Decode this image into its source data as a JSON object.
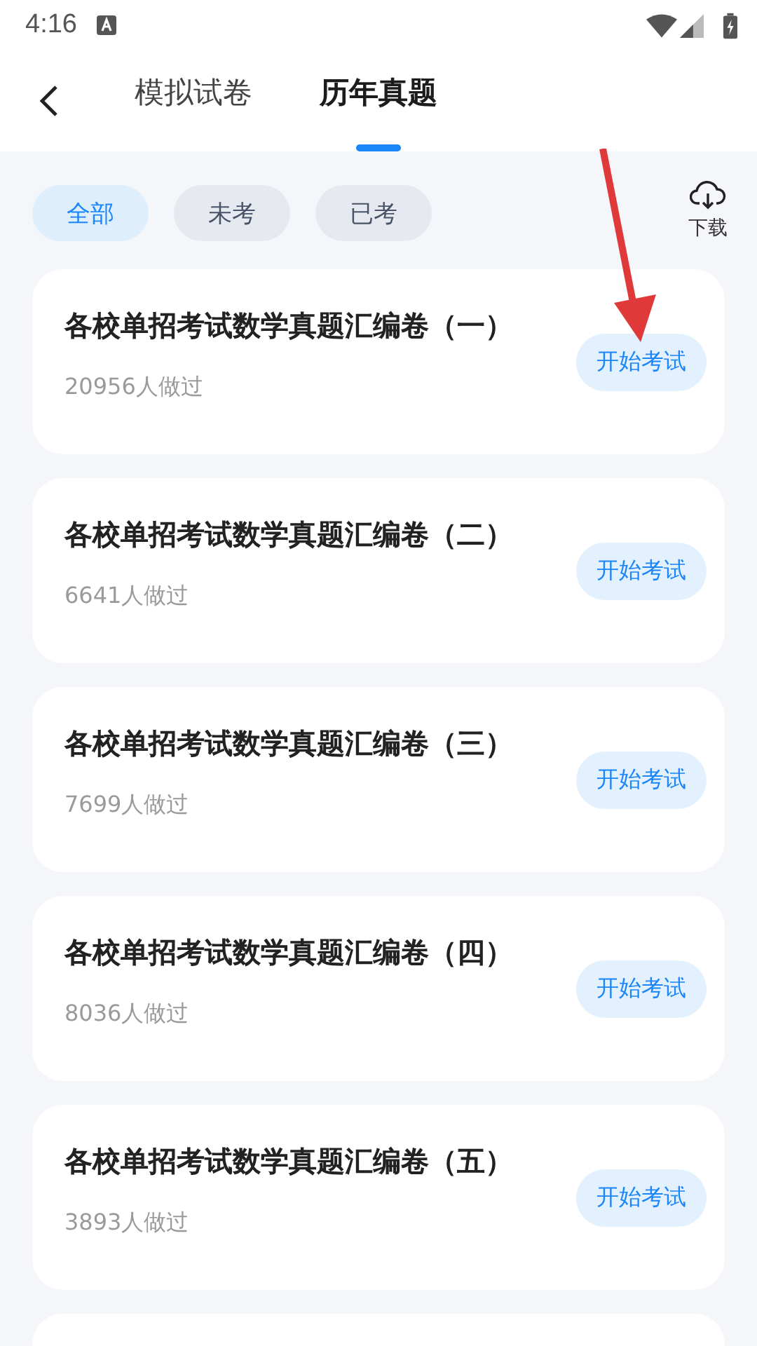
{
  "status_bar": {
    "time": "4:16"
  },
  "tabs": [
    {
      "label": "模拟试卷",
      "selected": false
    },
    {
      "label": "历年真题",
      "selected": true
    }
  ],
  "filters": [
    {
      "label": "全部",
      "selected": true
    },
    {
      "label": "未考",
      "selected": false
    },
    {
      "label": "已考",
      "selected": false
    }
  ],
  "download": {
    "label": "下载"
  },
  "papers": [
    {
      "title": "各校单招考试数学真题汇编卷（一）",
      "count": "20956人做过",
      "button": "开始考试"
    },
    {
      "title": "各校单招考试数学真题汇编卷（二）",
      "count": "6641人做过",
      "button": "开始考试"
    },
    {
      "title": "各校单招考试数学真题汇编卷（三）",
      "count": "7699人做过",
      "button": "开始考试"
    },
    {
      "title": "各校单招考试数学真题汇编卷（四）",
      "count": "8036人做过",
      "button": "开始考试"
    },
    {
      "title": "各校单招考试数学真题汇编卷（五）",
      "count": "3893人做过",
      "button": "开始考试"
    }
  ]
}
